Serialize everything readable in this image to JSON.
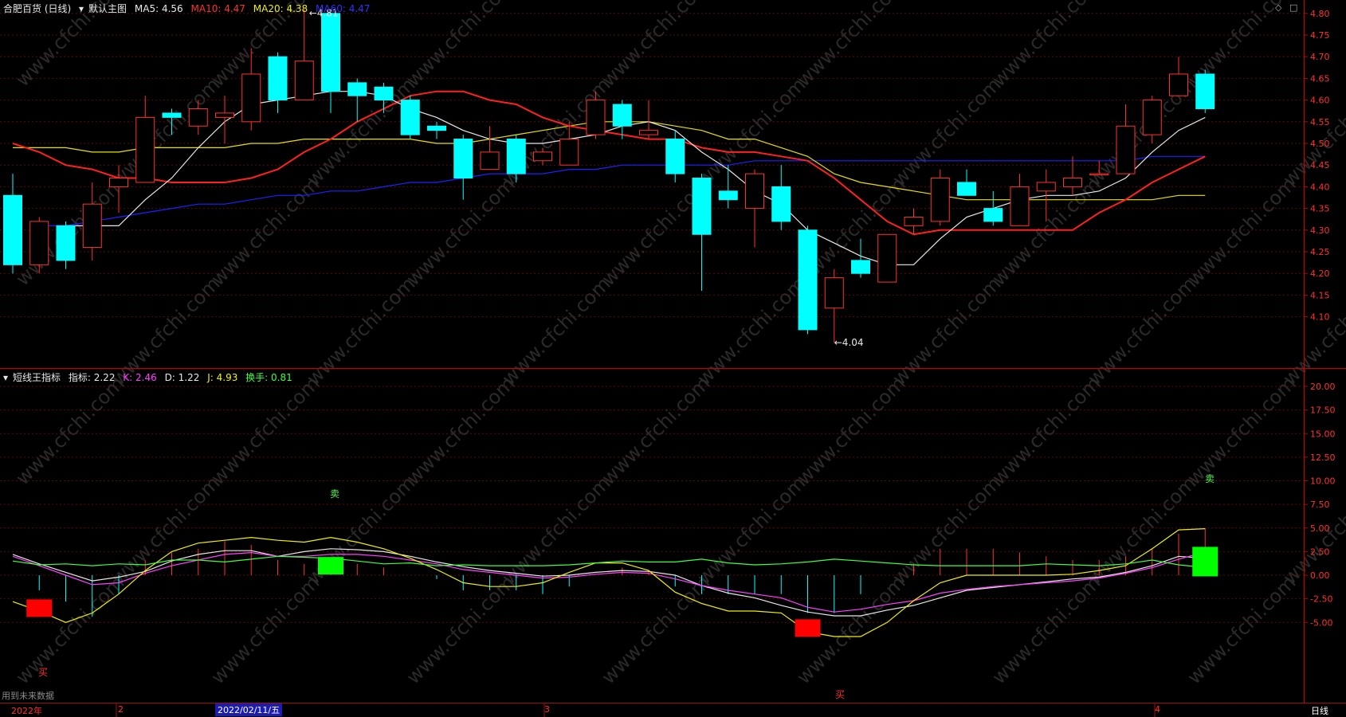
{
  "header_main": {
    "stock": "合肥百货 (日线)",
    "template": "默认主图",
    "ma5": "MA5: 4.56",
    "ma10": "MA10: 4.47",
    "ma20": "MA20: 4.38",
    "ma60": "MA60: 4.47"
  },
  "header_sub": {
    "indicator": "短线王指标",
    "value": "指标: 2.22",
    "k": "K: 2.46",
    "d": "D: 1.22",
    "j": "J: 4.93",
    "turnover": "换手: 0.81"
  },
  "high_label": "4.81",
  "low_label": "4.04",
  "buy_text": "买",
  "sell_text": "卖",
  "footer_note": "用到未来数据",
  "period_label": "日线",
  "cursor_date": "2022/02/11/五",
  "month_labels": [
    "2022年",
    "2",
    "3",
    "4"
  ],
  "watermark": "www.cfchi.com",
  "colors": {
    "up": "#ff3030",
    "down": "#00ffff",
    "ma5": "#e8e8e8",
    "ma10": "#ff2020",
    "ma20": "#e8e000",
    "ma60": "#2020ff"
  },
  "chart_data": [
    {
      "type": "candlestick",
      "ylim": [
        4.0,
        4.85
      ],
      "y_ticks": [
        4.1,
        4.15,
        4.2,
        4.25,
        4.3,
        4.35,
        4.4,
        4.45,
        4.5,
        4.55,
        4.6,
        4.65,
        4.7,
        4.75,
        4.8
      ],
      "candles": [
        {
          "o": 4.38,
          "h": 4.43,
          "l": 4.2,
          "c": 4.22
        },
        {
          "o": 4.22,
          "h": 4.33,
          "l": 4.2,
          "c": 4.32
        },
        {
          "o": 4.31,
          "h": 4.32,
          "l": 4.21,
          "c": 4.23
        },
        {
          "o": 4.26,
          "h": 4.41,
          "l": 4.23,
          "c": 4.36
        },
        {
          "o": 4.4,
          "h": 4.45,
          "l": 4.34,
          "c": 4.42
        },
        {
          "o": 4.41,
          "h": 4.61,
          "l": 4.41,
          "c": 4.56
        },
        {
          "o": 4.57,
          "h": 4.58,
          "l": 4.52,
          "c": 4.56
        },
        {
          "o": 4.54,
          "h": 4.6,
          "l": 4.52,
          "c": 4.58
        },
        {
          "o": 4.56,
          "h": 4.61,
          "l": 4.5,
          "c": 4.57
        },
        {
          "o": 4.55,
          "h": 4.72,
          "l": 4.53,
          "c": 4.66
        },
        {
          "o": 4.7,
          "h": 4.71,
          "l": 4.57,
          "c": 4.6
        },
        {
          "o": 4.6,
          "h": 4.81,
          "l": 4.6,
          "c": 4.69
        },
        {
          "o": 4.8,
          "h": 4.8,
          "l": 4.57,
          "c": 4.62
        },
        {
          "o": 4.64,
          "h": 4.65,
          "l": 4.55,
          "c": 4.61
        },
        {
          "o": 4.63,
          "h": 4.64,
          "l": 4.57,
          "c": 4.6
        },
        {
          "o": 4.6,
          "h": 4.61,
          "l": 4.51,
          "c": 4.52
        },
        {
          "o": 4.54,
          "h": 4.55,
          "l": 4.51,
          "c": 4.53
        },
        {
          "o": 4.51,
          "h": 4.52,
          "l": 4.37,
          "c": 4.42
        },
        {
          "o": 4.44,
          "h": 4.54,
          "l": 4.44,
          "c": 4.48
        },
        {
          "o": 4.51,
          "h": 4.52,
          "l": 4.41,
          "c": 4.43
        },
        {
          "o": 4.46,
          "h": 4.49,
          "l": 4.45,
          "c": 4.48
        },
        {
          "o": 4.45,
          "h": 4.55,
          "l": 4.45,
          "c": 4.51
        },
        {
          "o": 4.52,
          "h": 4.62,
          "l": 4.51,
          "c": 4.6
        },
        {
          "o": 4.59,
          "h": 4.6,
          "l": 4.51,
          "c": 4.54
        },
        {
          "o": 4.52,
          "h": 4.6,
          "l": 4.51,
          "c": 4.53
        },
        {
          "o": 4.51,
          "h": 4.53,
          "l": 4.41,
          "c": 4.43
        },
        {
          "o": 4.42,
          "h": 4.43,
          "l": 4.16,
          "c": 4.29
        },
        {
          "o": 4.39,
          "h": 4.45,
          "l": 4.35,
          "c": 4.37
        },
        {
          "o": 4.35,
          "h": 4.44,
          "l": 4.26,
          "c": 4.43
        },
        {
          "o": 4.4,
          "h": 4.45,
          "l": 4.3,
          "c": 4.32
        },
        {
          "o": 4.3,
          "h": 4.31,
          "l": 4.06,
          "c": 4.07
        },
        {
          "o": 4.12,
          "h": 4.21,
          "l": 4.04,
          "c": 4.19
        },
        {
          "o": 4.23,
          "h": 4.28,
          "l": 4.19,
          "c": 4.2
        },
        {
          "o": 4.18,
          "h": 4.29,
          "l": 4.18,
          "c": 4.29
        },
        {
          "o": 4.31,
          "h": 4.35,
          "l": 4.29,
          "c": 4.33
        },
        {
          "o": 4.32,
          "h": 4.44,
          "l": 4.31,
          "c": 4.42
        },
        {
          "o": 4.41,
          "h": 4.44,
          "l": 4.38,
          "c": 4.38
        },
        {
          "o": 4.35,
          "h": 4.39,
          "l": 4.31,
          "c": 4.32
        },
        {
          "o": 4.31,
          "h": 4.43,
          "l": 4.31,
          "c": 4.4
        },
        {
          "o": 4.39,
          "h": 4.44,
          "l": 4.32,
          "c": 4.41
        },
        {
          "o": 4.4,
          "h": 4.47,
          "l": 4.38,
          "c": 4.42
        },
        {
          "o": 4.43,
          "h": 4.46,
          "l": 4.43,
          "c": 4.43
        },
        {
          "o": 4.43,
          "h": 4.59,
          "l": 4.43,
          "c": 4.54
        },
        {
          "o": 4.52,
          "h": 4.61,
          "l": 4.5,
          "c": 4.6
        },
        {
          "o": 4.61,
          "h": 4.7,
          "l": 4.61,
          "c": 4.66
        },
        {
          "o": 4.66,
          "h": 4.67,
          "l": 4.57,
          "c": 4.58
        }
      ],
      "ma5": [
        null,
        null,
        4.31,
        4.31,
        4.31,
        4.37,
        4.42,
        4.49,
        4.55,
        4.59,
        4.6,
        4.61,
        4.62,
        4.62,
        4.61,
        4.58,
        4.56,
        4.53,
        4.51,
        4.5,
        4.5,
        4.51,
        4.52,
        4.54,
        4.55,
        4.53,
        4.48,
        4.44,
        4.39,
        4.36,
        4.3,
        4.27,
        4.24,
        4.22,
        4.22,
        4.28,
        4.33,
        4.35,
        4.37,
        4.38,
        4.38,
        4.39,
        4.42,
        4.48,
        4.53,
        4.56
      ],
      "ma10": [
        4.5,
        4.48,
        4.45,
        4.44,
        4.42,
        4.42,
        4.41,
        4.41,
        4.41,
        4.42,
        4.44,
        4.48,
        4.51,
        4.55,
        4.58,
        4.61,
        4.62,
        4.62,
        4.6,
        4.59,
        4.56,
        4.54,
        4.53,
        4.52,
        4.51,
        4.51,
        4.49,
        4.48,
        4.48,
        4.47,
        4.46,
        4.42,
        4.37,
        4.32,
        4.29,
        4.3,
        4.3,
        4.3,
        4.3,
        4.3,
        4.3,
        4.34,
        4.37,
        4.41,
        4.44,
        4.47
      ],
      "ma20": [
        4.49,
        4.49,
        4.49,
        4.48,
        4.48,
        4.49,
        4.49,
        4.49,
        4.49,
        4.5,
        4.5,
        4.51,
        4.51,
        4.51,
        4.51,
        4.51,
        4.5,
        4.5,
        4.51,
        4.52,
        4.53,
        4.54,
        4.55,
        4.55,
        4.55,
        4.54,
        4.53,
        4.51,
        4.51,
        4.49,
        4.47,
        4.43,
        4.41,
        4.4,
        4.39,
        4.38,
        4.37,
        4.37,
        4.37,
        4.37,
        4.37,
        4.37,
        4.37,
        4.37,
        4.38,
        4.38
      ],
      "ma60": [
        null,
        4.31,
        4.31,
        4.32,
        4.33,
        4.34,
        4.35,
        4.36,
        4.36,
        4.37,
        4.38,
        4.38,
        4.39,
        4.39,
        4.4,
        4.41,
        4.41,
        4.42,
        4.43,
        4.43,
        4.43,
        4.44,
        4.44,
        4.45,
        4.45,
        4.45,
        4.45,
        4.45,
        4.46,
        4.46,
        4.46,
        4.46,
        4.46,
        4.46,
        4.46,
        4.46,
        4.46,
        4.46,
        4.46,
        4.46,
        4.46,
        4.46,
        4.46,
        4.47,
        4.47,
        4.47
      ]
    },
    {
      "type": "line",
      "ylim": [
        -10,
        22
      ],
      "y_ticks": [
        20.0,
        17.5,
        15.0,
        12.5,
        10.0,
        7.5,
        5.0,
        2.5,
        0.0,
        -2.5,
        -5.0
      ],
      "series": [
        {
          "name": "指标",
          "values": [
            2.2,
            1.2,
            0.3,
            -0.6,
            -0.2,
            0.4,
            1.5,
            2.2,
            2.6,
            2.6,
            2.0,
            2.5,
            2.8,
            2.7,
            2.5,
            2.0,
            1.4,
            0.9,
            0.5,
            0.2,
            -0.1,
            0.0,
            0.3,
            0.5,
            0.4,
            0.0,
            -1.1,
            -1.9,
            -2.4,
            -3.2,
            -3.9,
            -4.3,
            -4.3,
            -3.7,
            -3.2,
            -2.4,
            -1.6,
            -1.3,
            -1.0,
            -0.7,
            -0.4,
            -0.2,
            0.3,
            1.0,
            2.0,
            1.8
          ]
        },
        {
          "name": "K",
          "values": [
            2.0,
            1.0,
            0.0,
            -1.0,
            -0.8,
            0.2,
            1.0,
            1.6,
            2.2,
            2.4,
            2.0,
            2.0,
            2.2,
            2.2,
            2.0,
            1.6,
            1.2,
            0.6,
            0.3,
            0.0,
            -0.3,
            -0.2,
            0.1,
            0.3,
            0.2,
            -0.4,
            -1.1,
            -1.6,
            -2.0,
            -2.4,
            -3.4,
            -3.9,
            -3.6,
            -3.1,
            -2.7,
            -1.9,
            -1.5,
            -1.2,
            -1.0,
            -0.8,
            -0.6,
            -0.3,
            0.2,
            0.8,
            1.7,
            2.46
          ]
        },
        {
          "name": "D",
          "values": [
            2.0,
            1.4,
            0.7,
            0.1,
            -0.3,
            -0.2,
            0.4,
            0.9,
            1.3,
            1.6,
            1.6,
            1.7,
            1.8,
            1.9,
            1.8,
            1.6,
            1.3,
            1.0,
            0.7,
            0.4,
            0.2,
            0.1,
            0.1,
            0.1,
            0.1,
            -0.1,
            -0.6,
            -1.1,
            -1.5,
            -1.9,
            -2.4,
            -2.9,
            -3.1,
            -3.1,
            -3.0,
            -2.6,
            -2.2,
            -1.9,
            -1.6,
            -1.3,
            -1.0,
            -0.7,
            -0.3,
            0.1,
            0.6,
            1.22
          ]
        },
        {
          "name": "J",
          "values": [
            -2.8,
            -3.8,
            -5.0,
            -4.0,
            -2.0,
            0.5,
            2.5,
            3.4,
            3.7,
            4.0,
            3.7,
            3.5,
            4.0,
            3.5,
            2.8,
            1.8,
            0.6,
            -0.8,
            -1.2,
            -1.2,
            -0.8,
            0.3,
            1.3,
            1.3,
            0.5,
            -1.8,
            -3.0,
            -3.8,
            -3.8,
            -4.0,
            -6.0,
            -6.5,
            -6.5,
            -5.0,
            -2.7,
            -0.8,
            0.0,
            0.0,
            0.0,
            0.0,
            0.1,
            0.5,
            1.0,
            2.8,
            4.8,
            4.93
          ]
        },
        {
          "name": "换手",
          "values": [
            1.5,
            1.1,
            1.2,
            1.0,
            1.2,
            1.1,
            1.6,
            1.6,
            1.4,
            1.7,
            2.0,
            1.9,
            1.8,
            1.5,
            1.2,
            1.3,
            1.0,
            1.1,
            1.0,
            1.0,
            1.0,
            1.1,
            1.3,
            1.5,
            1.4,
            1.4,
            1.7,
            1.3,
            1.1,
            1.2,
            1.4,
            1.7,
            1.5,
            1.3,
            1.1,
            1.0,
            1.0,
            1.0,
            1.0,
            1.2,
            1.1,
            1.0,
            1.2,
            1.6,
            1.1,
            0.81
          ]
        }
      ]
    }
  ]
}
